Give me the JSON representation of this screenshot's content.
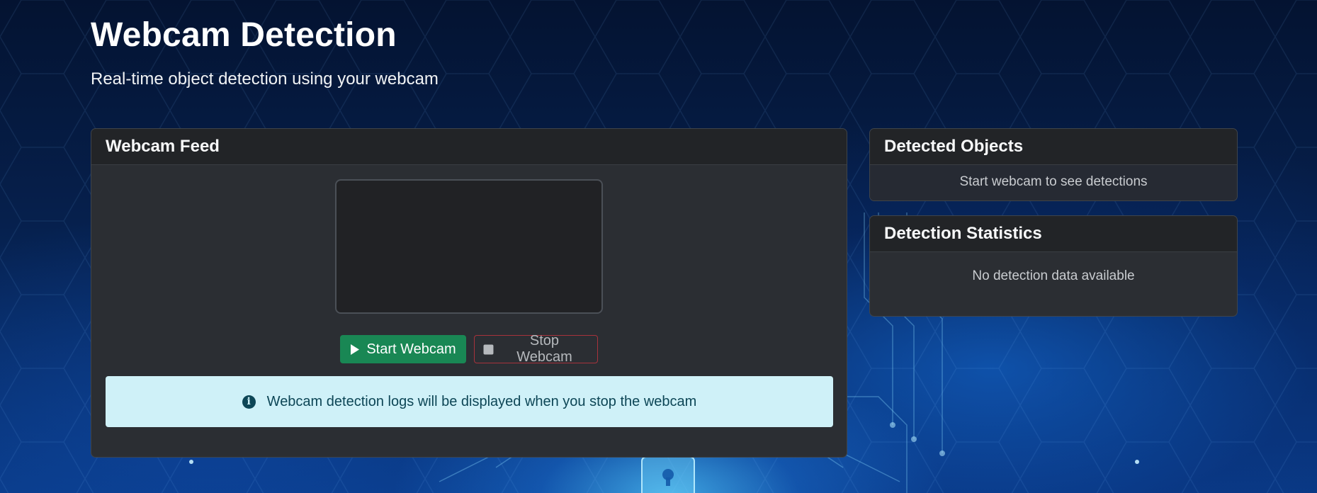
{
  "header": {
    "title": "Webcam Detection",
    "subtitle": "Real-time object detection using your webcam"
  },
  "feed": {
    "title": "Webcam Feed",
    "start_label": "Start Webcam",
    "stop_label": "Stop Webcam",
    "info_text": "Webcam detection logs will be displayed when you stop the webcam"
  },
  "detected": {
    "title": "Detected Objects",
    "message": "Start webcam to see detections"
  },
  "stats": {
    "title": "Detection Statistics",
    "message": "No detection data available"
  },
  "colors": {
    "start_button": "#198754",
    "stop_button_border": "#a8323c",
    "info_bg": "#cff1f8",
    "card_bg": "#2b2e33",
    "page_bg": "#04122e"
  },
  "icons": {
    "start": "play-icon",
    "stop": "stop-icon",
    "info": "info-circle-icon"
  }
}
